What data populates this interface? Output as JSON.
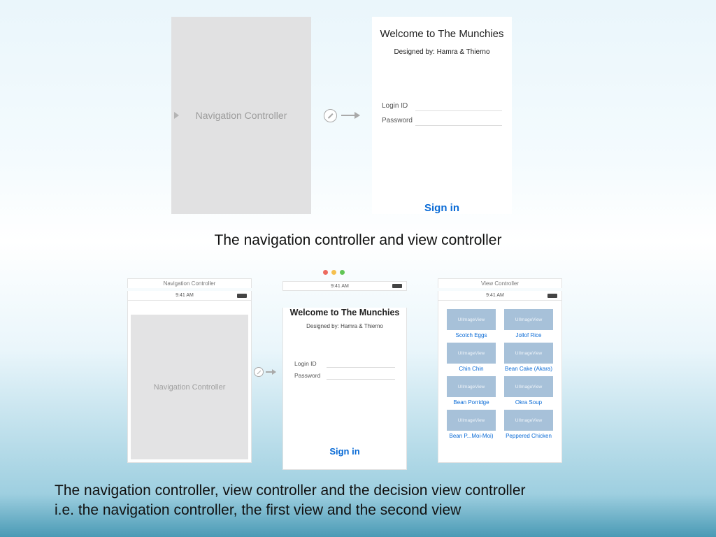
{
  "top": {
    "nav_label": "Navigation Controller",
    "welcome_title": "Welcome to The Munchies",
    "designed_by": "Designed by: Hamra & Thierno",
    "login_id_label": "Login ID",
    "password_label": "Password",
    "signin_label": "Sign in"
  },
  "caption1": "The navigation controller and view controller",
  "small": {
    "nav_header": "Navigation Controller",
    "view_header": "View Controller",
    "time": "9:41 AM",
    "nav_label": "Navigation Controller",
    "welcome_title": "Welcome to The Munchies",
    "designed_by": "Designed by: Hamra & Thierno",
    "login_id_label": "Login ID",
    "password_label": "Password",
    "signin_label": "Sign in",
    "placeholder": "UIImageView",
    "items": [
      "Scotch Eggs",
      "Jollof Rice",
      "Chin Chin",
      "Bean Cake (Akara)",
      "Bean Porridge",
      "Okra Soup",
      "Bean P...Moi-Moi)",
      "Peppered Chicken"
    ]
  },
  "caption2_line1": "The navigation controller, view controller and the decision view controller",
  "caption2_line2": "i.e. the navigation controller, the first view and the second view"
}
